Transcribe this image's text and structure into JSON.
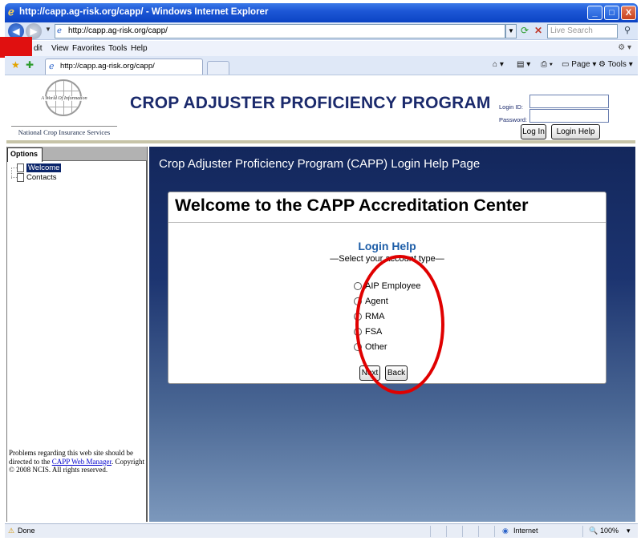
{
  "window": {
    "title": "http://capp.ag-risk.org/capp/ - Windows Internet Explorer",
    "minimize": "_",
    "maximize": "□",
    "close": "X"
  },
  "address": {
    "url": "http://capp.ag-risk.org/capp/",
    "search_placeholder": "Live Search"
  },
  "menu": {
    "items": [
      "dit",
      "View",
      "Favorites",
      "Tools",
      "Help"
    ]
  },
  "tabs": {
    "active_label": "http://capp.ag-risk.org/capp/",
    "page_label": "Page",
    "tools_label": "Tools"
  },
  "header": {
    "logo_tagline": "A World Of Information",
    "logo_name": "National Crop Insurance Services",
    "program_title": "CROP ADJUSTER PROFICIENCY PROGRAM",
    "login_id_label": "Login ID:",
    "password_label": "Password:",
    "login_button": "Log In",
    "login_help_button": "Login Help"
  },
  "sidebar": {
    "tab_label": "Options",
    "items": [
      {
        "label": "Welcome",
        "selected": true
      },
      {
        "label": "Contacts",
        "selected": false
      }
    ],
    "footer_before": "Problems regarding this web site should be directed to the ",
    "footer_link": "CAPP Web Manager",
    "footer_after": ". Copyright © 2008 NCIS. All rights reserved."
  },
  "main": {
    "page_title": "Crop Adjuster Proficiency Program (CAPP) Login Help Page",
    "card_heading": "Welcome to the CAPP Accreditation Center",
    "login_help_title": "Login Help",
    "login_help_subtitle": "—Select your account type—",
    "account_types": [
      "AIP Employee",
      "Agent",
      "RMA",
      "FSA",
      "Other"
    ],
    "next_button": "Next",
    "back_button": "Back"
  },
  "statusbar": {
    "status": "Done",
    "zone": "Internet",
    "zoom": "100%"
  },
  "colors": {
    "annotation": "#e00000",
    "title_bar": "#1d57d6",
    "program_title": "#1b2a6c",
    "login_help_title": "#1e5ea8"
  }
}
